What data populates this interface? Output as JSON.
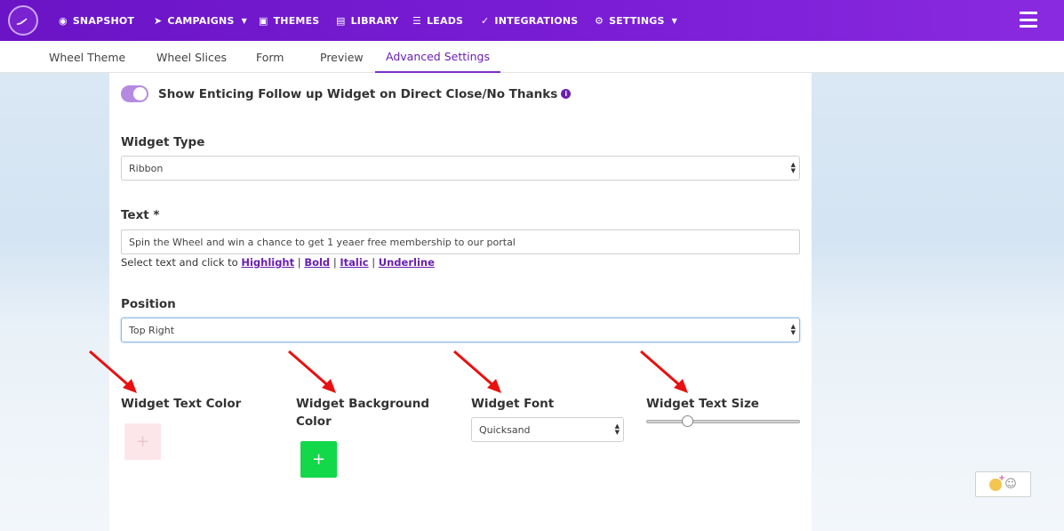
{
  "nav": {
    "items": [
      {
        "label": "SNAPSHOT",
        "icon": "dashboard-icon",
        "caret": false
      },
      {
        "label": "CAMPAIGNS",
        "icon": "paper-plane-icon",
        "caret": true
      },
      {
        "label": "THEMES",
        "icon": "image-icon",
        "caret": false
      },
      {
        "label": "LIBRARY",
        "icon": "list-icon",
        "caret": false
      },
      {
        "label": "LEADS",
        "icon": "list-bullets-icon",
        "caret": false
      },
      {
        "label": "INTEGRATIONS",
        "icon": "plug-icon",
        "caret": false
      },
      {
        "label": "SETTINGS",
        "icon": "gears-icon",
        "caret": true
      }
    ]
  },
  "tabs": [
    "Wheel Theme",
    "Wheel Slices",
    "Form",
    "Preview",
    "Advanced Settings"
  ],
  "active_tab": "Advanced Settings",
  "form": {
    "toggle_label": "Show Enticing Follow up Widget on Direct Close/No Thanks",
    "toggle_on": true,
    "widget_type_label": "Widget Type",
    "widget_type_value": "Ribbon",
    "text_label": "Text *",
    "text_value": "Spin the Wheel and win a chance to get 1 yeaer free membership to our portal",
    "helper_prefix": "Select text and click to",
    "helper_links": [
      "Highlight",
      "Bold",
      "Italic",
      "Underline"
    ],
    "position_label": "Position",
    "position_value": "Top Right",
    "text_color_label": "Widget Text Color",
    "bg_color_label": "Widget Background Color",
    "font_label": "Widget Font",
    "font_value": "Quicksand",
    "text_size_label": "Widget Text Size",
    "text_size_level": 0.27
  },
  "colors": {
    "nav_bg": "#7b1ed6",
    "accent": "#6a1fb0",
    "text_color_swatch": "#fde6ea",
    "bg_color_swatch": "#12d84a",
    "annotation_arrow": "#e81010"
  }
}
